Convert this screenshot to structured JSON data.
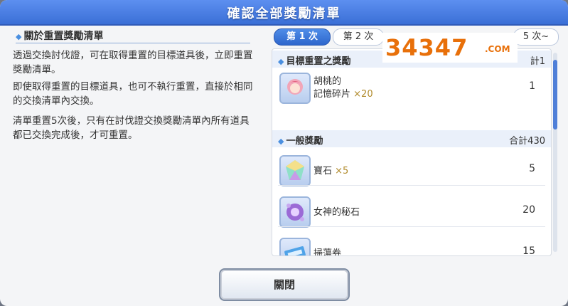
{
  "dialog": {
    "title": "確認全部獎勵清單"
  },
  "left": {
    "section_title": "關於重置獎勵清單",
    "paragraphs": [
      "透過交換討伐證，可在取得重置的目標道具後，立即重置獎勵清單。",
      "即使取得重置的目標道具，也可不執行重置，直接於相同的交換清單內交換。",
      "清單重置5次後，只有在討伐證交換獎勵清單內所有道具都已交換完成後，才可重置。"
    ]
  },
  "tabs": {
    "tab1": "第 1 次",
    "tab2": "第 2 次",
    "tab6": "5 次~"
  },
  "target_section": {
    "label": "目標重置之獎勵",
    "total": "計1"
  },
  "target_items": [
    {
      "name_line1": "胡桃的",
      "name_line2": "記憶碎片",
      "mult": "×20",
      "count": "1",
      "icon": "character-shard-icon"
    }
  ],
  "general_section": {
    "label": "一般獎勵",
    "total": "合計430"
  },
  "general_items": [
    {
      "name": "寶石",
      "mult": "×5",
      "count": "5",
      "icon": "gem-icon"
    },
    {
      "name": "女神的秘石",
      "mult": "",
      "count": "20",
      "icon": "goddess-stone-icon"
    },
    {
      "name": "掃蕩券",
      "mult": "",
      "count": "15",
      "icon": "sweep-ticket-icon"
    }
  ],
  "close_button": {
    "label": "關閉"
  },
  "watermark": {
    "brand": "34347",
    "domain": ".COM"
  }
}
